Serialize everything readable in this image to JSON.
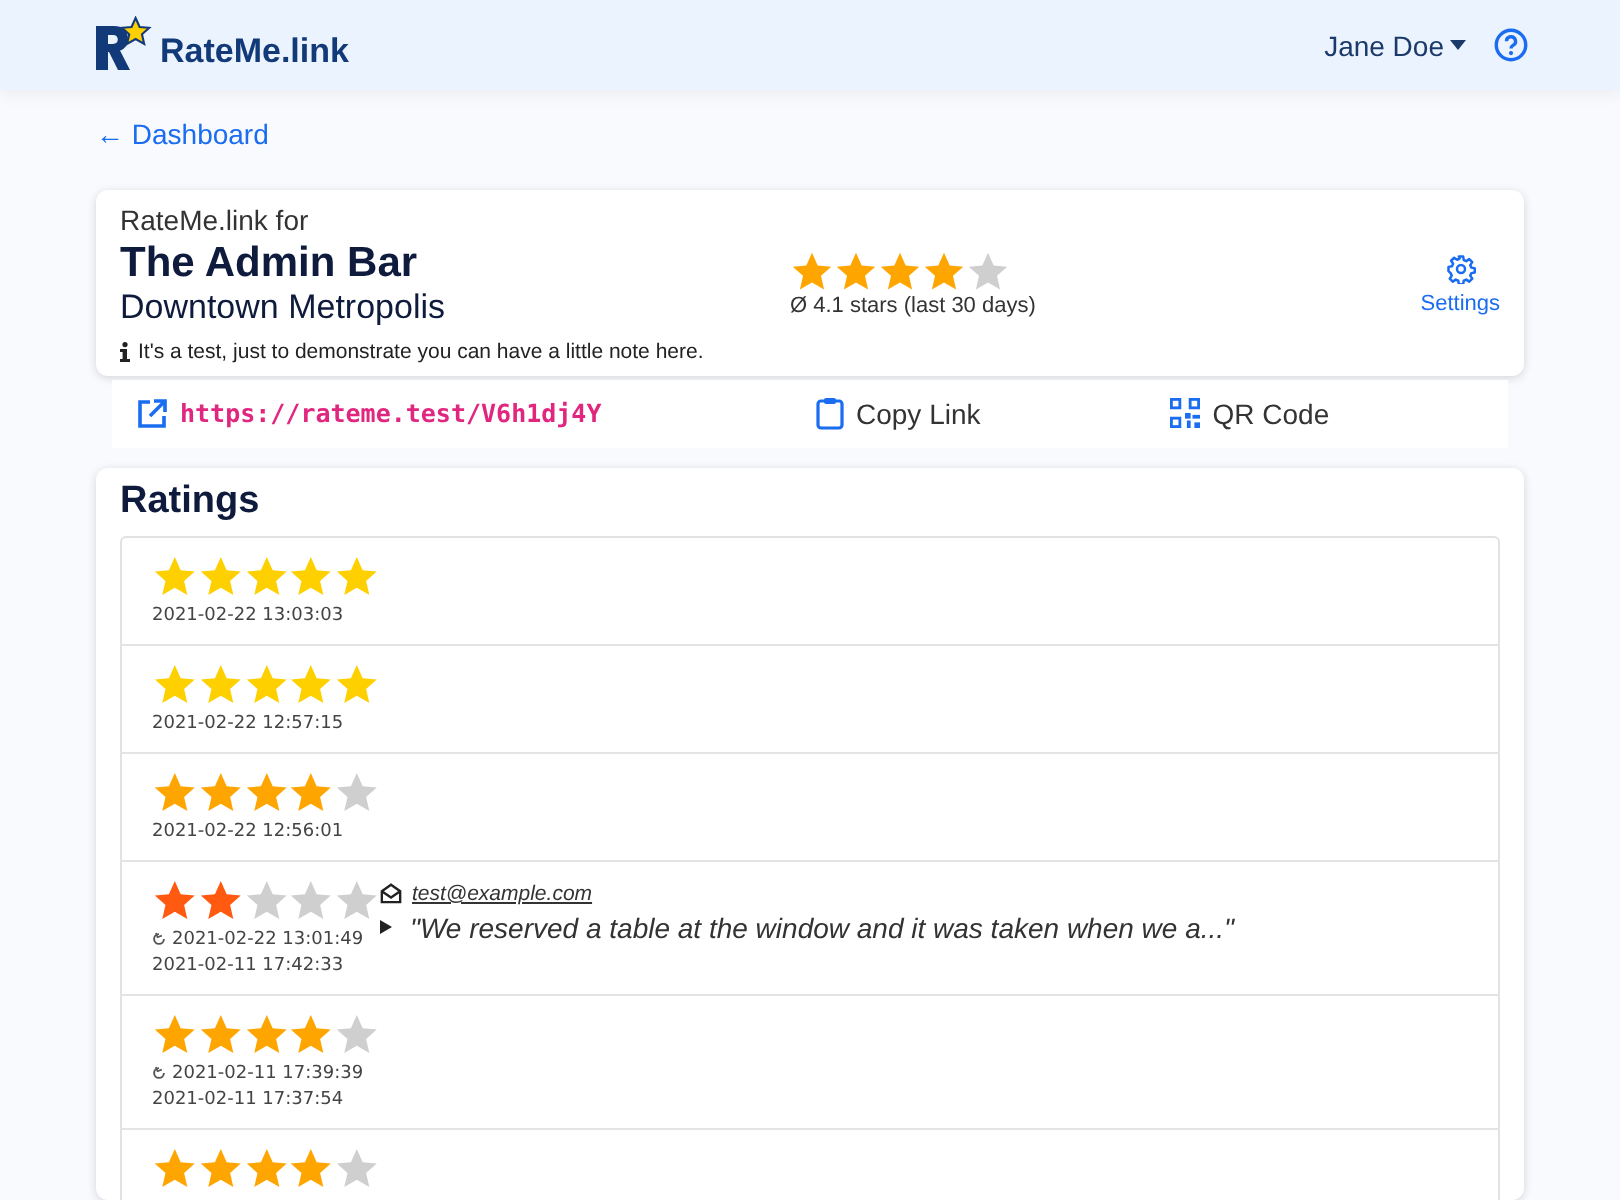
{
  "header": {
    "brand": "RateMe.link",
    "user": "Jane Doe"
  },
  "back_link": "← Dashboard",
  "venue": {
    "prefix": "RateMe.link for",
    "name": "The Admin Bar",
    "location": "Downtown Metropolis",
    "note": "It's a test, just to demonstrate you can have a little note here.",
    "stars": 4,
    "average": "Ø 4.1 stars (last 30 days)",
    "settings": "Settings"
  },
  "link_bar": {
    "url": "https://rateme.test/V6h1dj4Y",
    "copy": "Copy Link",
    "qr": "QR Code"
  },
  "ratings": {
    "title": "Ratings",
    "rows": [
      {
        "stars": 5,
        "time": "2021-02-22 13:03:03"
      },
      {
        "stars": 5,
        "time": "2021-02-22 12:57:15"
      },
      {
        "stars": 4,
        "time": "2021-02-22 12:56:01"
      },
      {
        "stars": 2,
        "edited": "2021-02-22 13:01:49",
        "time": "2021-02-11 17:42:33",
        "email": "test@example.com",
        "comment": "\"We reserved a table at the window and it was taken when we a...\"",
        "expanded": false
      },
      {
        "stars": 4,
        "edited": "2021-02-11 17:39:39",
        "time": "2021-02-11 17:37:54"
      },
      {
        "stars": 4
      }
    ]
  }
}
